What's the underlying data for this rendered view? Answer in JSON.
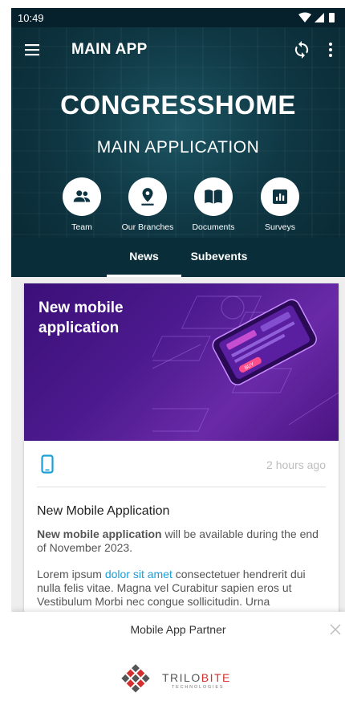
{
  "status_bar": {
    "time": "10:49"
  },
  "app_bar": {
    "title": "MAIN APP"
  },
  "header": {
    "brand": "CONGRESSHOME",
    "subtitle": "MAIN APPLICATION",
    "quick_actions": [
      {
        "label": "Team",
        "icon": "team-icon"
      },
      {
        "label": "Our Branches",
        "icon": "location-pin-icon"
      },
      {
        "label": "Documents",
        "icon": "book-icon"
      },
      {
        "label": "Surveys",
        "icon": "bar-chart-icon"
      }
    ]
  },
  "tabs": [
    {
      "label": "News",
      "active": true
    },
    {
      "label": "Subevents",
      "active": false
    }
  ],
  "post": {
    "banner_title": "New mobile application",
    "banner_badge": "BUY",
    "time_ago": "2 hours ago",
    "title": "New Mobile Application",
    "lead_bold": "New mobile application",
    "lead_rest": " will be available during the end of November 2023.",
    "body_start": "Lorem ipsum ",
    "body_link": "dolor sit amet",
    "body_rest": " consectetuer hendrerit dui nulla felis vitae. Magna vel Curabitur sapien eros ut Vestibulum Morbi nec congue sollicitudin. Urna"
  },
  "sponsor": {
    "title": "Mobile App Partner",
    "logo_word_a": "TRILO",
    "logo_word_b": "BITE",
    "logo_sub": "TECHNOLOGIES"
  },
  "colors": {
    "header_dark": "#082631",
    "accent_blue": "#1a9fd6",
    "banner_purple": "#4c1a8e",
    "logo_red": "#d32f2f"
  }
}
